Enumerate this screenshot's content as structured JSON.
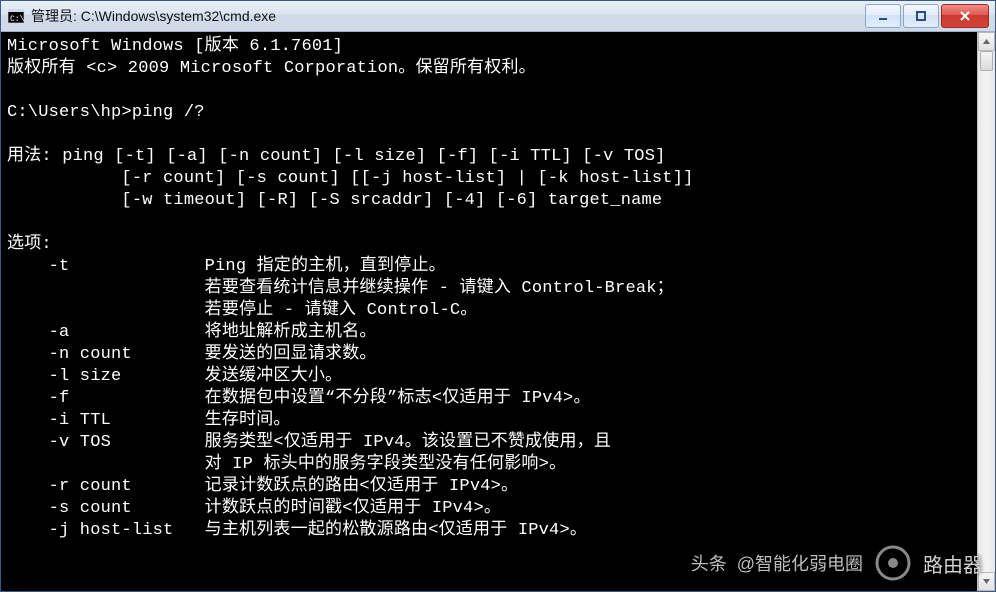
{
  "window": {
    "title": "管理员: C:\\Windows\\system32\\cmd.exe"
  },
  "controls": {
    "minimize_title": "Minimize",
    "maximize_title": "Maximize",
    "close_title": "Close"
  },
  "terminal": {
    "lines": [
      "Microsoft Windows [版本 6.1.7601]",
      "版权所有 <c> 2009 Microsoft Corporation。保留所有权利。",
      "",
      "C:\\Users\\hp>ping /?",
      "",
      "用法: ping [-t] [-a] [-n count] [-l size] [-f] [-i TTL] [-v TOS]",
      "           [-r count] [-s count] [[-j host-list] | [-k host-list]]",
      "           [-w timeout] [-R] [-S srcaddr] [-4] [-6] target_name",
      "",
      "选项:",
      "    -t             Ping 指定的主机，直到停止。",
      "                   若要查看统计信息并继续操作 - 请键入 Control-Break；",
      "                   若要停止 - 请键入 Control-C。",
      "    -a             将地址解析成主机名。",
      "    -n count       要发送的回显请求数。",
      "    -l size        发送缓冲区大小。",
      "    -f             在数据包中设置“不分段”标志<仅适用于 IPv4>。",
      "    -i TTL         生存时间。",
      "    -v TOS         服务类型<仅适用于 IPv4。该设置已不赞成使用，且",
      "                   对 IP 标头中的服务字段类型没有任何影响>。",
      "    -r count       记录计数跃点的路由<仅适用于 IPv4>。",
      "    -s count       计数跃点的时间戳<仅适用于 IPv4>。",
      "    -j host-list   与主机列表一起的松散源路由<仅适用于 IPv4>。"
    ]
  },
  "watermark": {
    "left": "头条",
    "mid": "@智能化弱电圈",
    "right": "路由器"
  }
}
